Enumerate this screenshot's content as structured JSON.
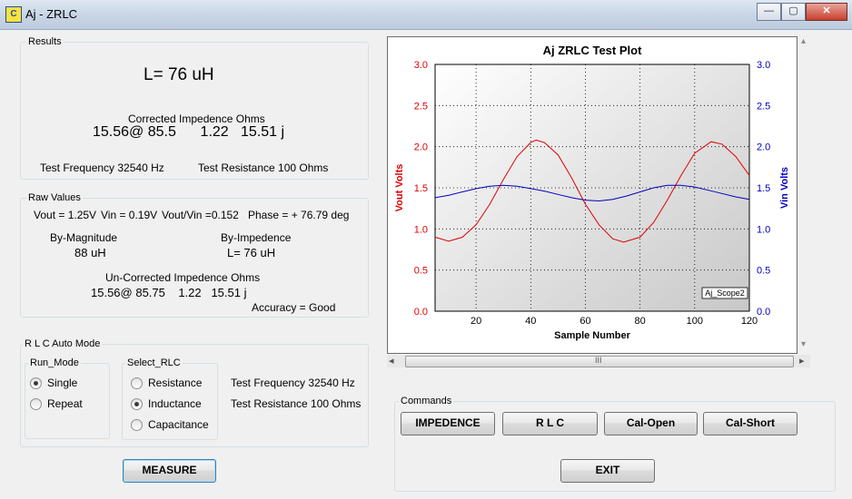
{
  "window": {
    "title": "Aj - ZRLC",
    "icon": "app-icon",
    "buttons": {
      "minimize": "—",
      "maximize": "▢",
      "close": "✕"
    }
  },
  "results": {
    "label": "Results",
    "inductance": "L= 76 uH",
    "corrected_header": "Corrected Impedence Ohms",
    "corrected_values": "15.56@ 85.5      1.22   15.51 j",
    "test_frequency": "Test Frequency  32540  Hz",
    "test_resistance": "Test Resistance  100 Ohms"
  },
  "raw": {
    "label": "Raw Values",
    "vout": "Vout = 1.25V",
    "vin": "Vin = 0.19V",
    "ratio": "Vout/Vin =0.152",
    "phase": "Phase = + 76.79 deg",
    "by_magnitude_label": "By-Magnitude",
    "by_magnitude_value": "88 uH",
    "by_impedence_label": "By-Impedence",
    "by_impedence_value": "L= 76 uH",
    "uncorrected_header": "Un-Corrected Impedence Ohms",
    "uncorrected_values": "15.56@ 85.75    1.22   15.51 j",
    "accuracy": "Accuracy = Good"
  },
  "auto_mode": {
    "label": "R L C Auto Mode",
    "run_mode_label": "Run_Mode",
    "run_modes": [
      {
        "label": "Single",
        "checked": true
      },
      {
        "label": "Repeat",
        "checked": false
      }
    ],
    "select_label": "Select_RLC",
    "select_options": [
      {
        "label": "Resistance",
        "checked": false
      },
      {
        "label": "Inductance",
        "checked": true
      },
      {
        "label": "Capacitance",
        "checked": false
      }
    ],
    "test_frequency": "Test Frequency  32540  Hz",
    "test_resistance": "Test Resistance  100 Ohms"
  },
  "measure_button": "MEASURE",
  "commands": {
    "label": "Commands",
    "impedence": "IMPEDENCE",
    "rlc": "R  L  C",
    "cal_open": "Cal-Open",
    "cal_short": "Cal-Short",
    "exit": "EXIT"
  },
  "scroll": {
    "thumb_glyph": "III",
    "left_arrow": "◂",
    "right_arrow": "▸",
    "up_arrow": "▴",
    "down_arrow": "▾"
  },
  "chart_data": {
    "type": "line",
    "title": "Aj ZRLC Test Plot",
    "xlabel": "Sample Number",
    "ylabel": "Vout Volts",
    "y2label": "Vin Volts",
    "xlim": [
      5,
      120
    ],
    "ylim": [
      0,
      3.0
    ],
    "y2lim": [
      0,
      3.0
    ],
    "x_ticks": [
      20,
      40,
      60,
      80,
      100,
      120
    ],
    "y_ticks": [
      "0.0",
      "0.5",
      "1.0",
      "1.5",
      "2.0",
      "2.5",
      "3.0"
    ],
    "grid": true,
    "annotation": "Aj_Scope2",
    "series": [
      {
        "name": "Vout Volts",
        "color": "#e00000",
        "axis": "left",
        "x": [
          5,
          10,
          15,
          20,
          25,
          30,
          35,
          40,
          42,
          45,
          50,
          55,
          60,
          65,
          70,
          74,
          80,
          85,
          90,
          95,
          100,
          106,
          110,
          115,
          120
        ],
        "y": [
          0.9,
          0.85,
          0.9,
          1.05,
          1.3,
          1.6,
          1.88,
          2.05,
          2.08,
          2.05,
          1.9,
          1.62,
          1.3,
          1.05,
          0.88,
          0.84,
          0.9,
          1.08,
          1.35,
          1.65,
          1.92,
          2.06,
          2.03,
          1.88,
          1.65
        ]
      },
      {
        "name": "Vin Volts",
        "color": "#0000c0",
        "axis": "right",
        "x": [
          5,
          10,
          15,
          20,
          25,
          30,
          35,
          40,
          45,
          50,
          55,
          60,
          65,
          70,
          75,
          80,
          85,
          90,
          95,
          100,
          105,
          110,
          115,
          120
        ],
        "y": [
          1.38,
          1.41,
          1.45,
          1.49,
          1.52,
          1.53,
          1.52,
          1.49,
          1.46,
          1.42,
          1.38,
          1.35,
          1.34,
          1.36,
          1.4,
          1.45,
          1.5,
          1.53,
          1.53,
          1.51,
          1.47,
          1.43,
          1.39,
          1.36
        ]
      }
    ],
    "colors": {
      "vout_axis": "#e00000",
      "vin_axis": "#0000c0"
    }
  }
}
